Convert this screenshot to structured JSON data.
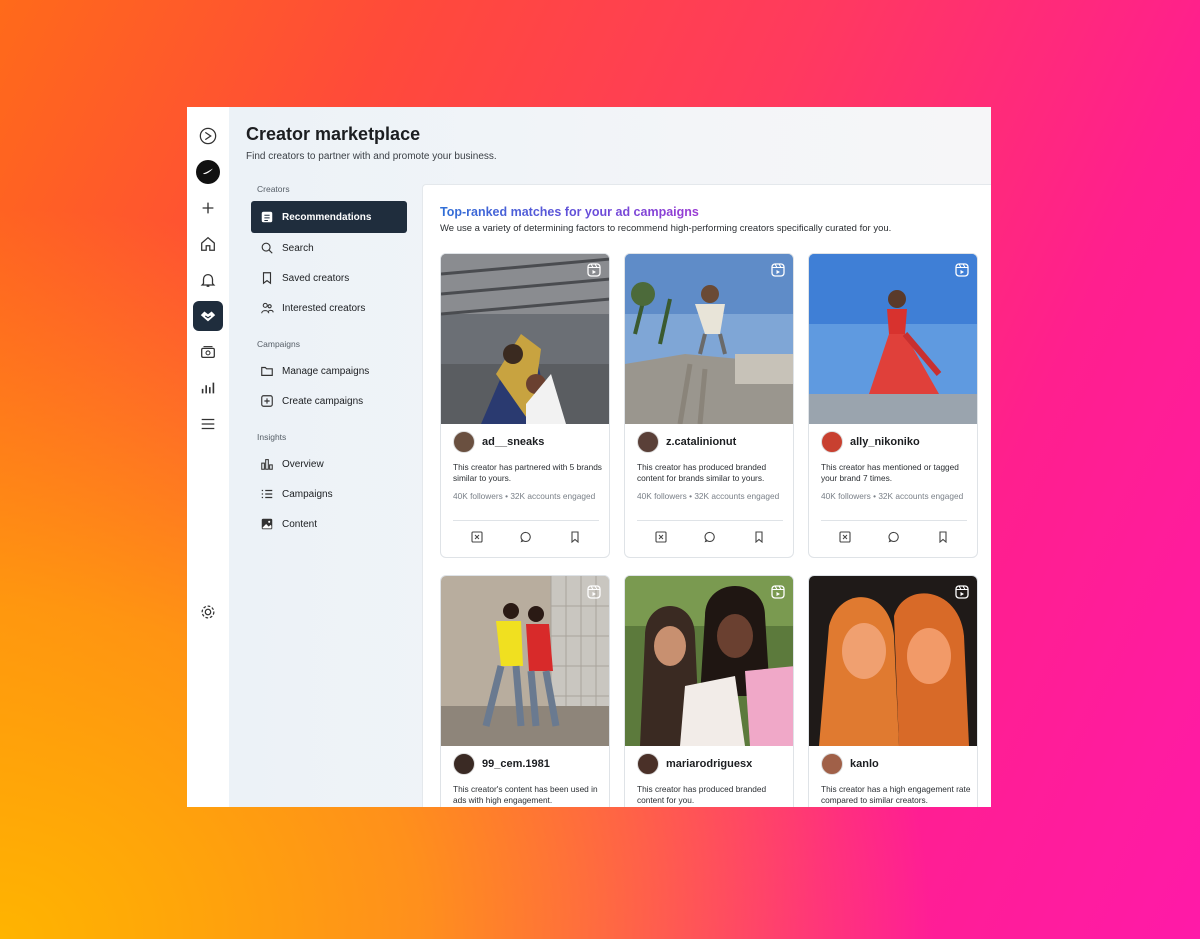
{
  "app": {
    "title": "Creator marketplace",
    "subtitle": "Find creators to partner with and promote your business."
  },
  "rail": {
    "icons": [
      "meta-icon",
      "brand-logo",
      "plus-icon",
      "home-icon",
      "bell-icon",
      "handshake-icon",
      "money-icon",
      "chart-icon",
      "menu-icon",
      "settings-icon"
    ],
    "active": "handshake-icon"
  },
  "subnav": {
    "creators_label": "Creators",
    "recommendations": "Recommendations",
    "search": "Search",
    "saved": "Saved creators",
    "interested": "Interested creators",
    "campaigns_label": "Campaigns",
    "manage": "Manage campaigns",
    "create": "Create campaigns",
    "insights_label": "Insights",
    "overview": "Overview",
    "campaigns": "Campaigns",
    "content": "Content"
  },
  "panel": {
    "title": "Top-ranked matches for your ad campaigns",
    "subtitle": "We use a variety of determining factors to recommend high-performing creators specifically curated for you."
  },
  "creators": [
    {
      "username": "ad__sneaks",
      "desc": "This creator has partnered with 5 brands similar to yours.",
      "stats": "40K followers • 32K accounts engaged"
    },
    {
      "username": "z.catalinionut",
      "desc": "This creator has produced branded content for brands similar to yours.",
      "stats": "40K followers • 32K accounts engaged"
    },
    {
      "username": "ally_nikoniko",
      "desc": "This creator has mentioned or tagged your brand 7 times.",
      "stats": "40K followers • 32K accounts engaged"
    },
    {
      "username": "99_cem.1981",
      "desc": "This creator's content has been used in ads with high engagement.",
      "stats": ""
    },
    {
      "username": "mariarodriguesx",
      "desc": "This creator has produced branded content for you.",
      "stats": ""
    },
    {
      "username": "kanlo",
      "desc": "This creator has a high engagement rate compared to similar creators.",
      "stats": ""
    }
  ],
  "colors": {
    "accent_dark": "#1f2d3d",
    "title_gradient_start": "#2f6fd6",
    "title_gradient_end": "#9a3bd3"
  }
}
